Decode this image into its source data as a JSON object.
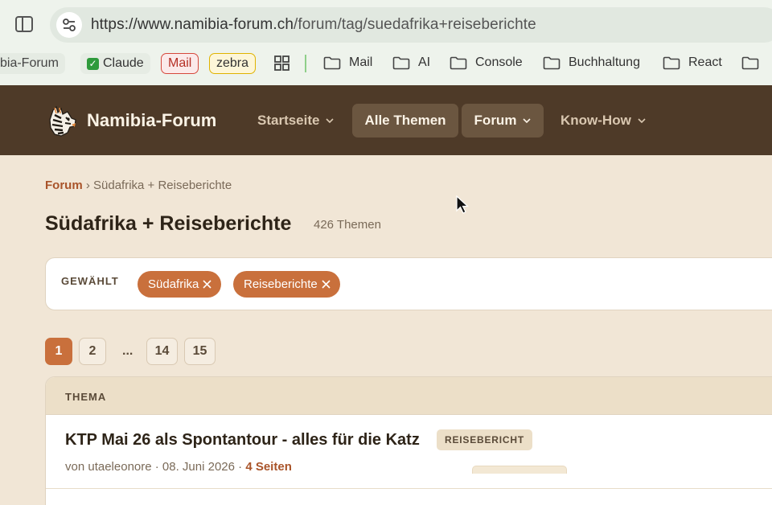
{
  "browser": {
    "url_host": "https://www.namibia-forum.ch",
    "url_path": "/forum/tag/suedafrika+reiseberichte",
    "bookmarks": {
      "first": "bia-Forum",
      "claude": "Claude",
      "mail_chip": "Mail",
      "zebra_chip": "zebra",
      "folders": [
        "Mail",
        "AI",
        "Console",
        "Buchhaltung",
        "React"
      ]
    }
  },
  "site": {
    "logo_text": "Namibia-Forum",
    "nav": {
      "startseite": "Startseite",
      "alle_themen": "Alle Themen",
      "forum": "Forum",
      "know_how": "Know-How"
    }
  },
  "main": {
    "breadcrumb_link": "Forum",
    "breadcrumb_sep": " › ",
    "breadcrumb_current": "Südafrika + Reiseberichte",
    "title": "Südafrika + Reiseberichte",
    "topic_count": "426 Themen",
    "filter": {
      "label": "GEWÄHLT",
      "tags": [
        "Südafrika",
        "Reiseberichte"
      ]
    },
    "pagination": [
      "1",
      "2",
      "...",
      "14",
      "15"
    ],
    "table": {
      "header": "THEMA",
      "rows": [
        {
          "title": "KTP Mai 26 als Spontantour - alles für die Katz",
          "badge": "REISEBERICHT",
          "meta_prefix": "von utaeleonore · 08. Juni 2026 · ",
          "pages": "4 Seiten"
        }
      ]
    }
  },
  "colors": {
    "header_bg": "#4e3a28",
    "accent": "#c9703c",
    "page_bg": "#f1e6d6"
  }
}
